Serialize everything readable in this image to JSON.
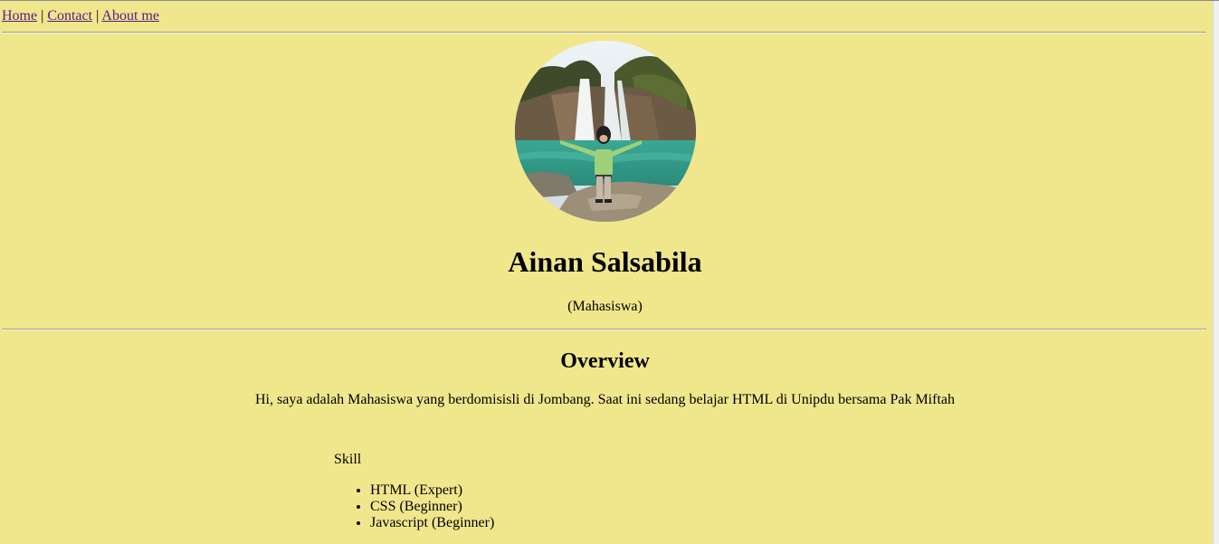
{
  "nav": {
    "links": [
      "Home",
      "Contact",
      "About me"
    ],
    "separator": "|"
  },
  "profile": {
    "name": "Ainan Salsabila",
    "role": "(Mahasiswa)"
  },
  "overview": {
    "title": "Overview",
    "text": "Hi, saya adalah Mahasiswa yang berdomisisli di Jombang. Saat ini sedang belajar HTML di Unipdu bersama Pak Miftah"
  },
  "skill": {
    "heading": "Skill",
    "items": [
      "HTML (Expert)",
      "CSS (Beginner)",
      "Javascript (Beginner)"
    ]
  },
  "colors": {
    "background": "#f0e68c",
    "link": "#551a8b"
  }
}
